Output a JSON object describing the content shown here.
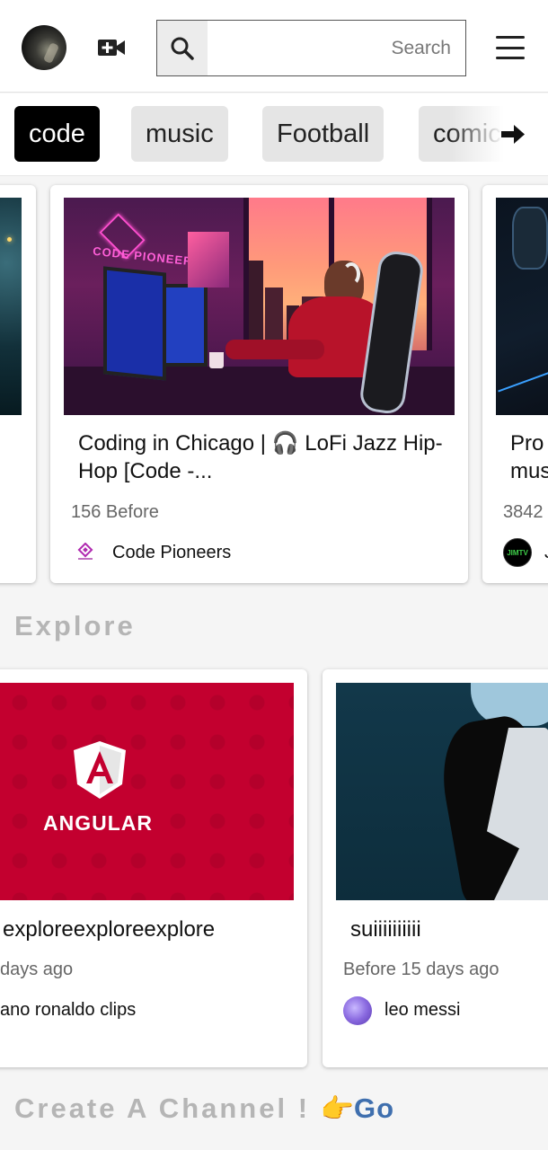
{
  "header": {
    "search_placeholder": "Search",
    "icons": {
      "avatar": "user-avatar",
      "camera": "video-camera-add-icon",
      "search": "search-icon",
      "menu": "hamburger-menu-icon"
    }
  },
  "chips": [
    "code",
    "music",
    "Football",
    "comic"
  ],
  "featured": [
    {
      "title": "",
      "meta": "",
      "channel": ""
    },
    {
      "title": "Coding in Chicago | 🎧 LoFi Jazz Hip-Hop [Code -...",
      "meta": "156 Before",
      "channel": "Code Pioneers",
      "thumb_text": "CODE PIONEERS"
    },
    {
      "title_line1": "Pro",
      "title_line2": "mus",
      "meta": "3842",
      "channel": "J",
      "avatar_text": "JIMTV"
    }
  ],
  "explore": {
    "title": "Explore",
    "cards": [
      {
        "title": "exploreexploreexplore",
        "meta": "days ago",
        "channel": "ano ronaldo clips",
        "thumb_text": "ANGULAR",
        "logo_letter": "A"
      },
      {
        "title": "suiiiiiiiiii",
        "meta": "Before 15 days ago",
        "channel": "leo messi"
      }
    ]
  },
  "footer": {
    "create_text": "Create A Channel !",
    "hand": "👉",
    "go": "Go"
  },
  "colors": {
    "active_chip": "#000000",
    "chip": "#e5e5e5",
    "section_title": "#b5b5b5",
    "go_link": "#3f6fae",
    "angular_red": "#c3002f"
  }
}
